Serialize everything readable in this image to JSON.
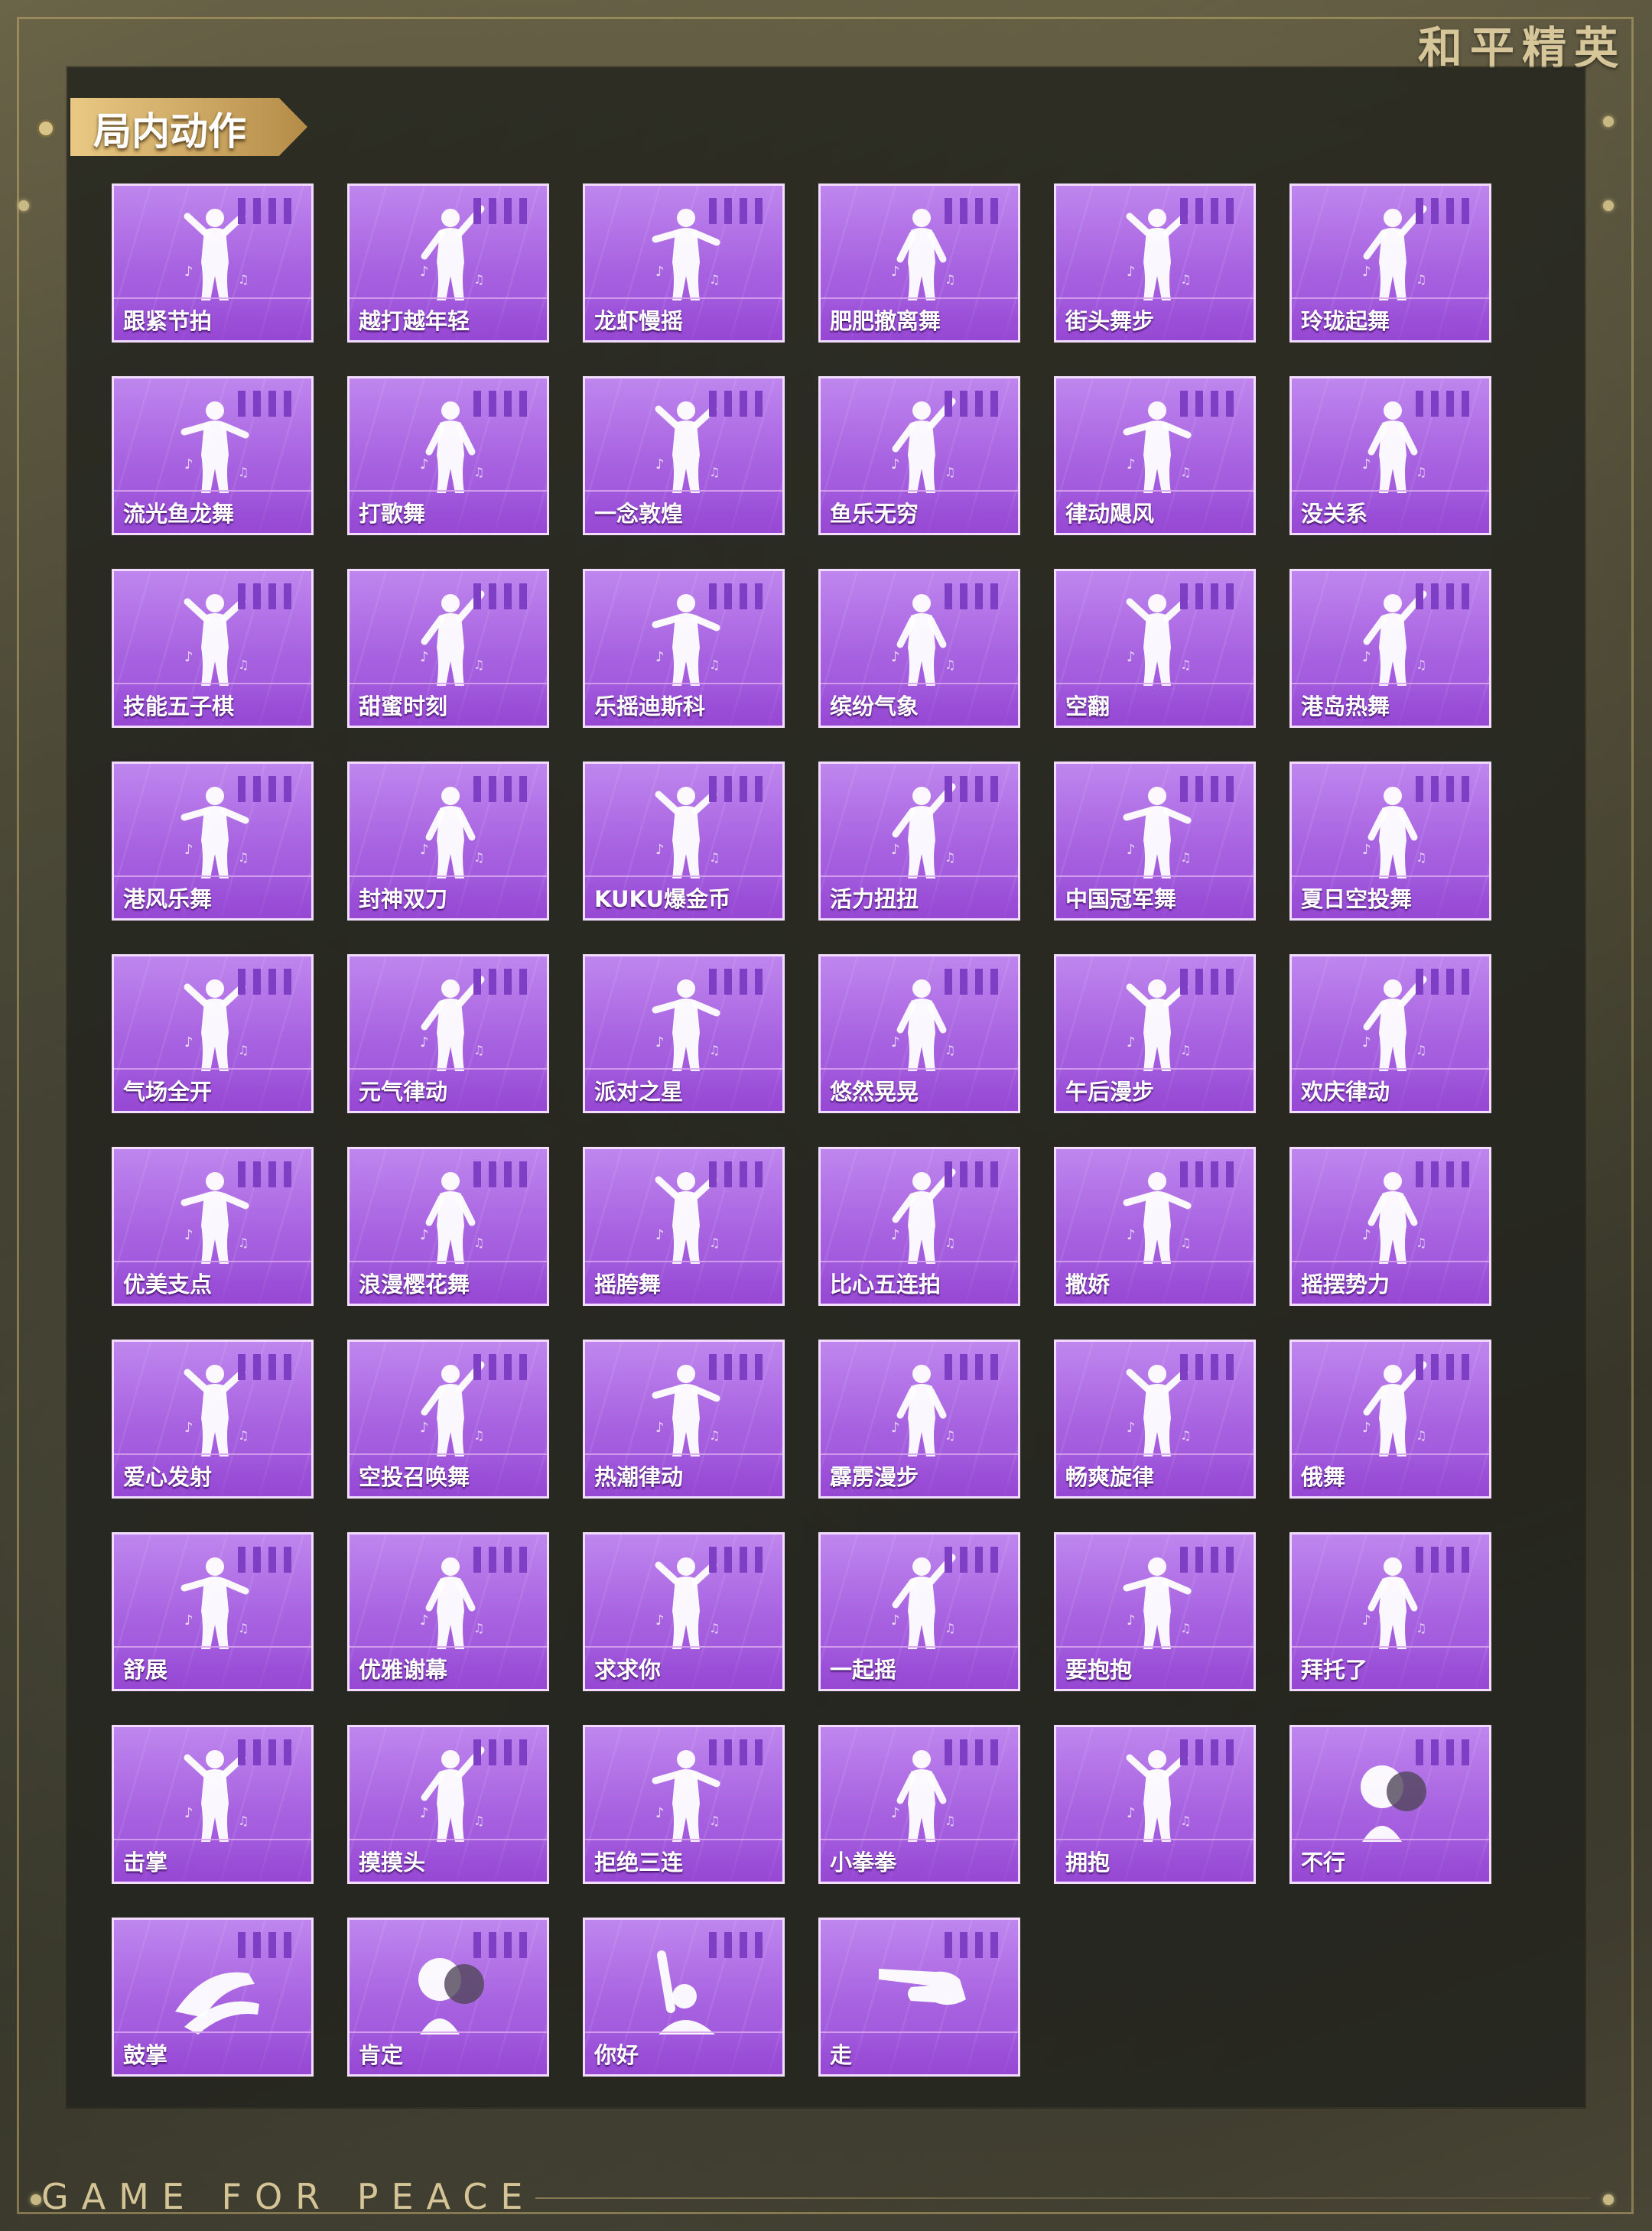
{
  "brand": {
    "logo_text": "和平精英",
    "footer_text": "GAME FOR PEACE"
  },
  "section": {
    "title": "局内动作"
  },
  "colors": {
    "card_top": "#bf86ee",
    "card_bottom": "#9a4fd8",
    "card_border": "#f2dcff",
    "tag_gold": "#e9c983",
    "panel": "#22241e"
  },
  "emotes": [
    {
      "name": "跟紧节拍",
      "icon": "dancer-icon"
    },
    {
      "name": "越打越年轻",
      "icon": "dancer-icon"
    },
    {
      "name": "龙虾慢摇",
      "icon": "dancer-icon"
    },
    {
      "name": "肥肥撤离舞",
      "icon": "dancer-icon"
    },
    {
      "name": "街头舞步",
      "icon": "dancer-icon"
    },
    {
      "name": "玲珑起舞",
      "icon": "dancer-icon"
    },
    {
      "name": "流光鱼龙舞",
      "icon": "dancer-icon"
    },
    {
      "name": "打歌舞",
      "icon": "dancer-icon"
    },
    {
      "name": "一念敦煌",
      "icon": "dancer-icon"
    },
    {
      "name": "鱼乐无穷",
      "icon": "dancer-icon"
    },
    {
      "name": "律动飓风",
      "icon": "dancer-icon"
    },
    {
      "name": "没关系",
      "icon": "dancer-icon"
    },
    {
      "name": "技能五子棋",
      "icon": "dancer-icon"
    },
    {
      "name": "甜蜜时刻",
      "icon": "dancer-icon"
    },
    {
      "name": "乐摇迪斯科",
      "icon": "dancer-icon"
    },
    {
      "name": "缤纷气象",
      "icon": "dancer-icon"
    },
    {
      "name": "空翻",
      "icon": "dancer-icon"
    },
    {
      "name": "港岛热舞",
      "icon": "dancer-icon"
    },
    {
      "name": "港风乐舞",
      "icon": "dancer-icon"
    },
    {
      "name": "封神双刀",
      "icon": "dancer-icon"
    },
    {
      "name": "KUKU爆金币",
      "icon": "dancer-icon"
    },
    {
      "name": "活力扭扭",
      "icon": "dancer-icon"
    },
    {
      "name": "中国冠军舞",
      "icon": "dancer-icon"
    },
    {
      "name": "夏日空投舞",
      "icon": "dancer-icon"
    },
    {
      "name": "气场全开",
      "icon": "dancer-icon"
    },
    {
      "name": "元气律动",
      "icon": "dancer-icon"
    },
    {
      "name": "派对之星",
      "icon": "dancer-icon"
    },
    {
      "name": "悠然晃晃",
      "icon": "dancer-icon"
    },
    {
      "name": "午后漫步",
      "icon": "dancer-icon"
    },
    {
      "name": "欢庆律动",
      "icon": "dancer-icon"
    },
    {
      "name": "优美支点",
      "icon": "dancer-icon"
    },
    {
      "name": "浪漫樱花舞",
      "icon": "dancer-icon"
    },
    {
      "name": "摇胯舞",
      "icon": "dancer-icon"
    },
    {
      "name": "比心五连拍",
      "icon": "dancer-icon"
    },
    {
      "name": "撒娇",
      "icon": "dancer-icon"
    },
    {
      "name": "摇摆势力",
      "icon": "dancer-icon"
    },
    {
      "name": "爱心发射",
      "icon": "dancer-icon"
    },
    {
      "name": "空投召唤舞",
      "icon": "dancer-icon"
    },
    {
      "name": "热潮律动",
      "icon": "dancer-icon"
    },
    {
      "name": "霹雳漫步",
      "icon": "dancer-icon"
    },
    {
      "name": "畅爽旋律",
      "icon": "dancer-icon"
    },
    {
      "name": "俄舞",
      "icon": "dancer-icon"
    },
    {
      "name": "舒展",
      "icon": "dancer-icon"
    },
    {
      "name": "优雅谢幕",
      "icon": "dancer-icon"
    },
    {
      "name": "求求你",
      "icon": "dancer-icon"
    },
    {
      "name": "一起摇",
      "icon": "dancer-icon"
    },
    {
      "name": "要抱抱",
      "icon": "dancer-icon"
    },
    {
      "name": "拜托了",
      "icon": "dancer-icon"
    },
    {
      "name": "击掌",
      "icon": "dancer-icon"
    },
    {
      "name": "摸摸头",
      "icon": "dancer-icon"
    },
    {
      "name": "拒绝三连",
      "icon": "dancer-icon"
    },
    {
      "name": "小拳拳",
      "icon": "dancer-icon"
    },
    {
      "name": "拥抱",
      "icon": "dancer-icon"
    },
    {
      "name": "不行",
      "icon": "heads-icon"
    },
    {
      "name": "鼓掌",
      "icon": "clap-hands-icon"
    },
    {
      "name": "肯定",
      "icon": "heads-icon"
    },
    {
      "name": "你好",
      "icon": "wave-icon"
    },
    {
      "name": "走",
      "icon": "point-hand-icon"
    }
  ]
}
